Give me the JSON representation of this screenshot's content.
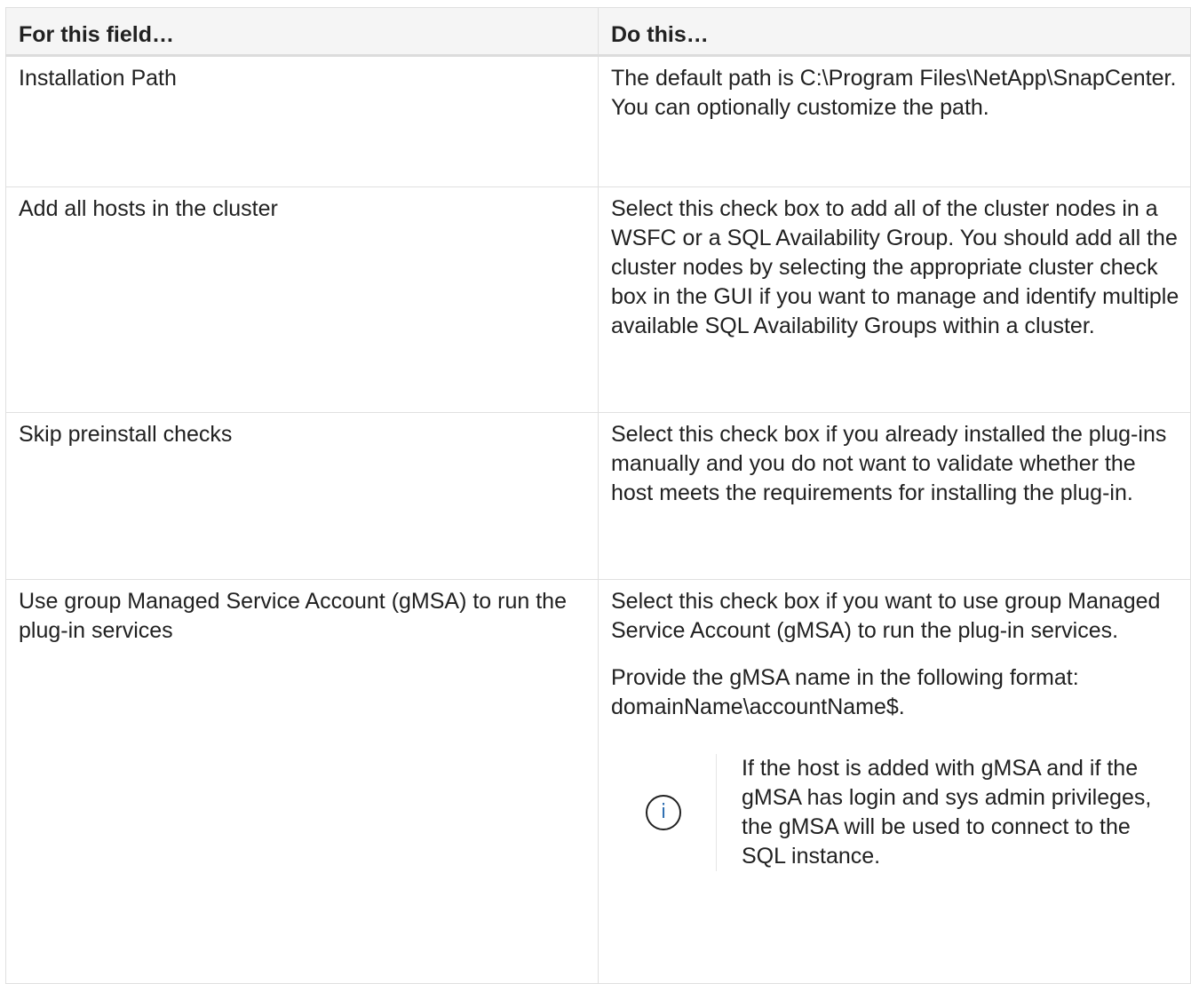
{
  "table": {
    "headers": [
      "For this field…",
      "Do this…"
    ],
    "rows": [
      {
        "field": "Installation Path",
        "action": [
          "The default path is C:\\Program Files\\NetApp\\SnapCenter. You can optionally customize the path."
        ]
      },
      {
        "field": "Add all hosts in the cluster",
        "action": [
          "Select this check box to add all of the cluster nodes in a WSFC or a SQL Availability Group. You should add all the cluster nodes by selecting the appropriate cluster check box in the GUI if you want to manage and identify multiple available SQL Availability Groups within a cluster."
        ]
      },
      {
        "field": "Skip preinstall checks",
        "action": [
          "Select this check box if you already installed the plug-ins manually and you do not want to validate whether the host meets the requirements for installing the plug-in."
        ]
      },
      {
        "field": "Use group Managed Service Account (gMSA) to run the plug-in services",
        "action": [
          "Select this check box if you want to use group Managed Service Account (gMSA) to run the plug-in services.",
          "Provide the gMSA name in the following format: domainName\\accountName$."
        ],
        "note": {
          "icon": "info-icon",
          "glyph": "i",
          "text": "If the host is added with gMSA and if the gMSA has login and sys admin privileges, the gMSA will be used to connect to the SQL instance."
        }
      }
    ]
  },
  "colors": {
    "border": "#e0e0e0",
    "header_bg": "#f5f5f5",
    "text": "#212121",
    "info_icon": "#2b6cb0"
  }
}
